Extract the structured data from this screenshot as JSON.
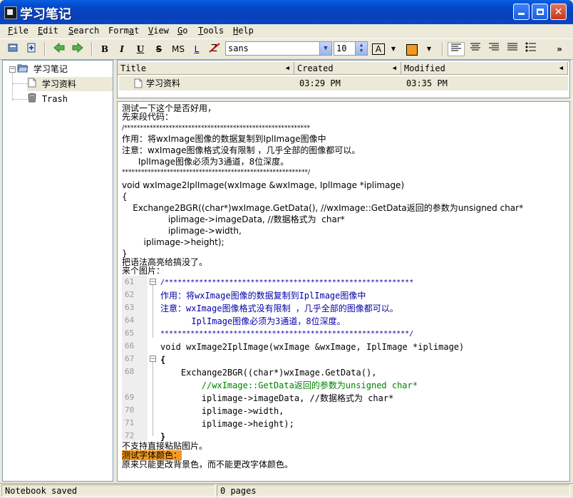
{
  "window": {
    "title": "学习笔记",
    "minimize": "_",
    "maximize": "□",
    "close": "✕"
  },
  "menu": [
    {
      "key": "F",
      "rest": "ile"
    },
    {
      "key": "E",
      "rest": "dit"
    },
    {
      "key": "S",
      "rest": "earch"
    },
    {
      "pre": "Form",
      "key": "a",
      "rest": "t"
    },
    {
      "key": "V",
      "rest": "iew"
    },
    {
      "key": "G",
      "rest": "o"
    },
    {
      "key": "T",
      "rest": "ools"
    },
    {
      "key": "H",
      "rest": "elp"
    }
  ],
  "toolbar": {
    "bold": "B",
    "italic": "I",
    "underline": "U",
    "strike": "S",
    "mono": "MS",
    "link": "L",
    "font_family": "sans",
    "font_size": "10",
    "text_color_glyph": "A",
    "bg_color": "#f39a1e",
    "more": "»"
  },
  "tree": {
    "root": "学习笔记",
    "child": "学习资料",
    "trash": "Trash"
  },
  "notes_list": {
    "headers": {
      "title": "Title",
      "created": "Created",
      "modified": "Modified"
    },
    "rows": [
      {
        "title": "学习资料",
        "created": "03:29 PM",
        "modified": "03:35 PM"
      }
    ]
  },
  "editor": {
    "lines": [
      "测试一下这个是否好用，",
      "先来段代码：",
      "/**********************************************************",
      "作用：将wxImage图像的数据复制到IplImage图像中",
      "注意：wxImage图像格式没有限制 ，几乎全部的图像都可以。",
      "      IplImage图像必须为3通道，8位深度。",
      "**********************************************************/",
      "void wxImage2IplImage(wxImage &wxImage, IplImage *iplimage)",
      "{",
      "    Exchange2BGR((char*)wxImage.GetData(), //wxImage::GetData返回的参数为unsigned char*",
      "                 iplimage->imageData, //数据格式为  char*",
      "                 iplimage->width,",
      "        iplimage->height);",
      "}",
      "把语法高亮给搞没了。",
      "来个图片："
    ],
    "code_numbers": [
      "61",
      "62",
      "63",
      "64",
      "65",
      "66",
      "67",
      "68",
      "69",
      "70",
      "71",
      "72"
    ],
    "code_lines": [
      "/**********************************************************",
      "作用：将wxImage图像的数据复制到IplImage图像中",
      "注意：wxImage图像格式没有限制 ，几乎全部的图像都可以。",
      "      IplImage图像必须为3通道，8位深度。",
      "**********************************************************/",
      "void wxImage2IplImage(wxImage &wxImage, IplImage *iplimage)",
      "{",
      "    Exchange2BGR((char*)wxImage.GetData(),",
      "        //wxImage::GetData返回的参数为unsigned char*",
      "        iplimage->imageData, //数据格式为 char*",
      "        iplimage->width,",
      "        iplimage->height);",
      "}"
    ],
    "after_lines": [
      "不支持直接粘贴图片。",
      "测试字体颜色：",
      "原来只能更改背景色，而不能更改字体颜色。"
    ],
    "highlight_color": "#f39a1e"
  },
  "status": {
    "left": "Notebook saved",
    "right": "0 pages"
  }
}
